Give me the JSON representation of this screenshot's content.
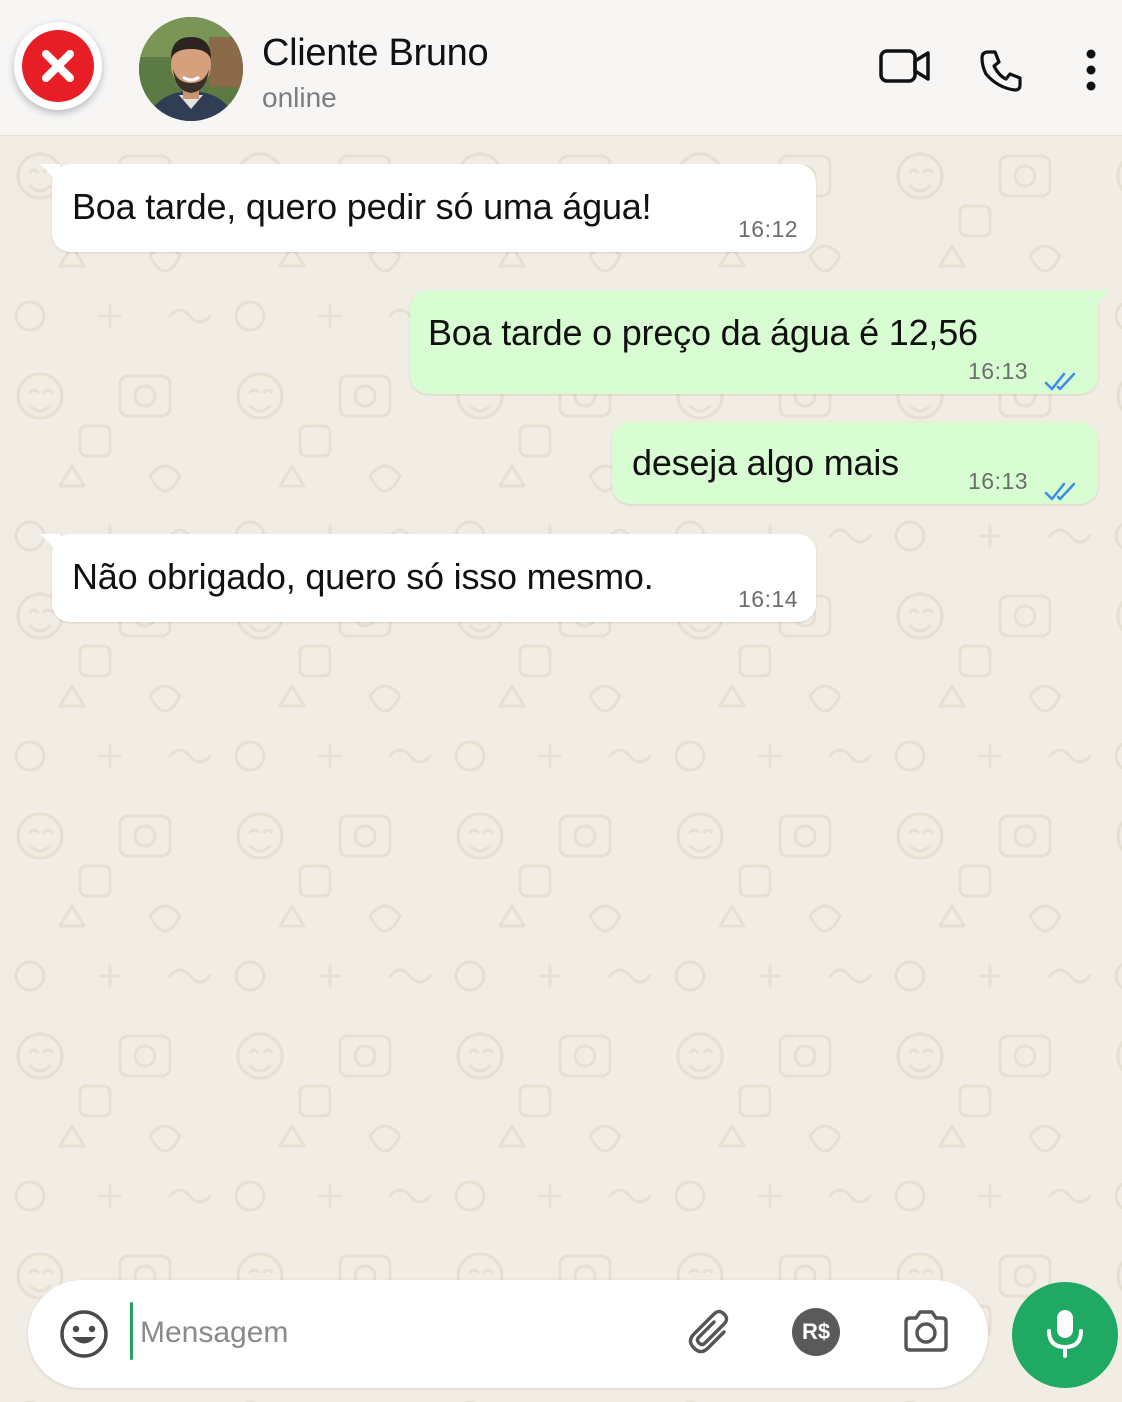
{
  "header": {
    "contact_name": "Cliente Bruno",
    "status": "online"
  },
  "messages": [
    {
      "direction": "incoming",
      "text": "Boa tarde, quero pedir só uma água!",
      "time": "16:12"
    },
    {
      "direction": "outgoing",
      "text": "Boa tarde o preço da água é 12,56",
      "time": "16:13",
      "status": "read"
    },
    {
      "direction": "outgoing",
      "text": "deseja algo mais",
      "time": "16:13",
      "status": "read"
    },
    {
      "direction": "incoming",
      "text": "Não obrigado, quero só isso mesmo.",
      "time": "16:14"
    }
  ],
  "composer": {
    "placeholder": "Mensagem",
    "currency_badge": "R$"
  },
  "icons": {
    "close": "close-icon",
    "video": "video-call-icon",
    "phone": "phone-icon",
    "menu": "more-vertical-icon",
    "emoji": "emoji-icon",
    "attach": "paperclip-icon",
    "camera": "camera-icon",
    "mic": "mic-icon",
    "read_ticks": "double-check-icon"
  },
  "colors": {
    "accent_green": "#20a962",
    "outgoing_bubble": "#d9fdd3",
    "incoming_bubble": "#ffffff",
    "close_red": "#e81e26",
    "read_tick_blue": "#3b8fe6",
    "wallpaper": "#f2ede4"
  }
}
